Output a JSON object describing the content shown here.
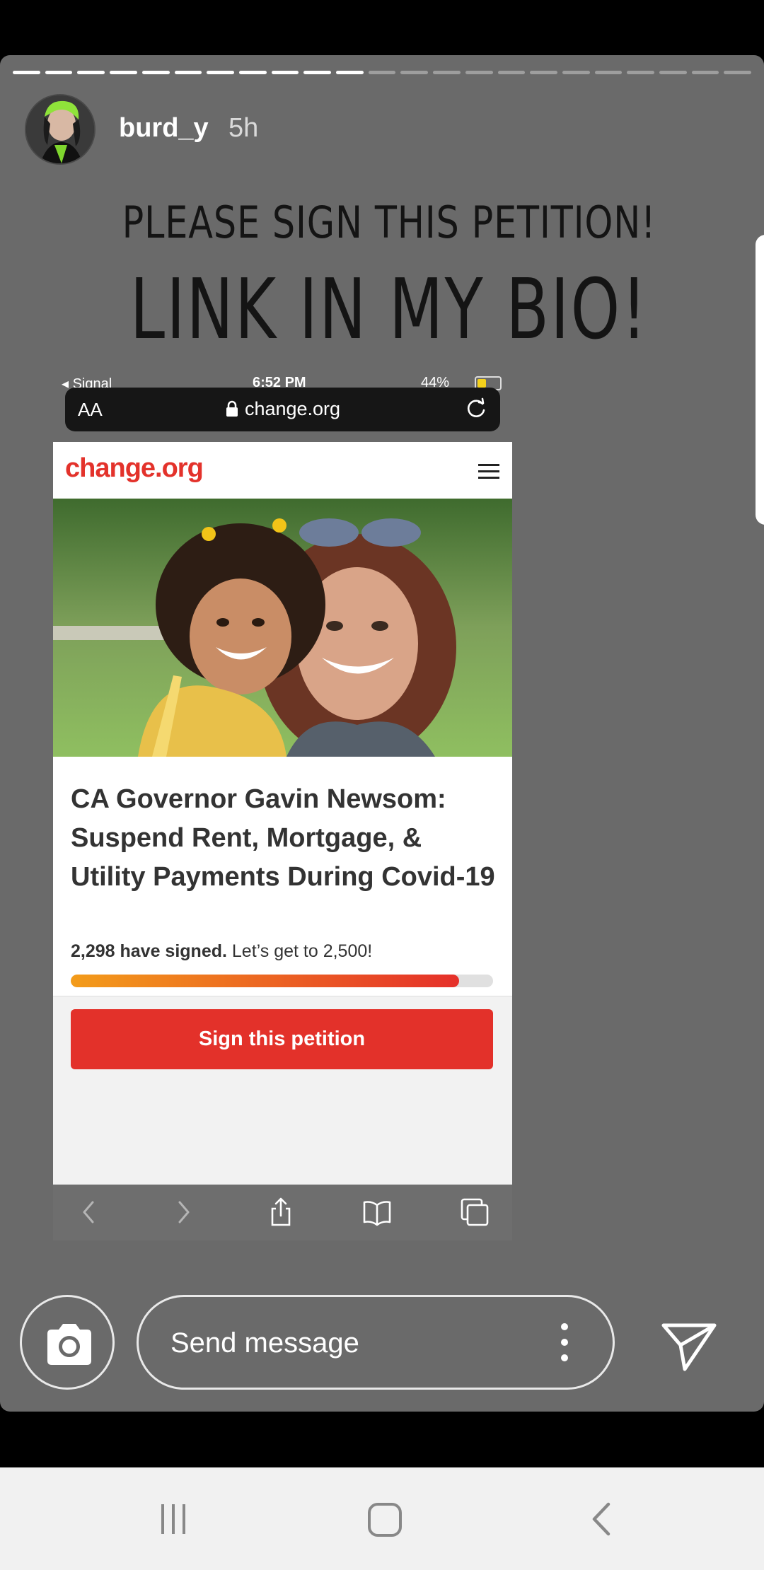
{
  "story": {
    "progress_total": 23,
    "progress_done": 11,
    "username": "burd_y",
    "time": "5h",
    "headline_line1": "PLEASE SIGN THIS PETITION!",
    "headline_line2": "LINK IN MY BIO!"
  },
  "screenshot": {
    "status": {
      "carrier": "◂ Signal",
      "time": "6:52 PM",
      "battery": "44%"
    },
    "browser": {
      "text_size": "AA",
      "url": "change.org"
    },
    "site": {
      "logo": "change.org",
      "petition_title": "CA Governor Gavin Newsom: Suspend Rent, Mortgage, & Utility Payments During Covid-19",
      "signed_count": "2,298 have signed.",
      "goal_text": " Let’s get to 2,500!",
      "progress": 0.919,
      "sign_button": "Sign this petition"
    }
  },
  "reply": {
    "placeholder": "Send message"
  },
  "colors": {
    "brand": "#e3322b",
    "story_bg": "#6a6a6a"
  }
}
